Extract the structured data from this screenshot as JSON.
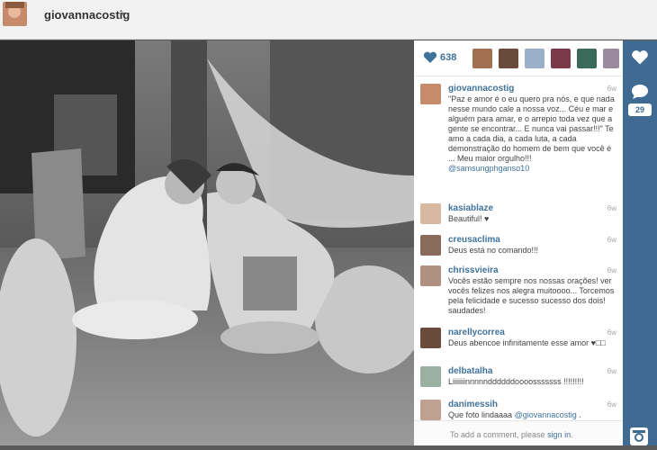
{
  "header": {
    "username": "giovannacostig",
    "caret": "▾"
  },
  "post": {
    "likes_count": "638",
    "comment_count": "29",
    "caption": {
      "username": "giovannacostig",
      "time": "6w",
      "text": "\"Paz e amor é o eu quero pra nós, e que nada nesse mundo cale a nossa voz... Céu e mar e alguém para amar, e o arrepio toda vez que a gente se encontrar... E nunca vai passar!!!\" Te amo a cada dia, a cada luta, a cada demonstração do homem de bem que você é ... Meu maior orgulho!!!",
      "mention": "@samsungphganso10"
    },
    "comments": [
      {
        "username": "kasiablaze",
        "time": "6w",
        "text": "Beautiful! ♥"
      },
      {
        "username": "creusaclima",
        "time": "6w",
        "text": "Deus está no comando!!!"
      },
      {
        "username": "chrissvieira",
        "time": "6w",
        "text": "Vocês estão sempre nos nossas orações! ver vocês felizes nos alegra muitoooo... Torcemos pela felicidade e sucesso sucesso dos dois! saudades!"
      },
      {
        "username": "narellycorrea",
        "time": "6w",
        "text": "Deus abencoe infinitamente esse amor ♥□□"
      },
      {
        "username": "delbatalha",
        "time": "6w",
        "text": "Liiiiiiinnnnnddddddoooosssssss !!!!!!!!!"
      },
      {
        "username": "danimessih",
        "time": "6w",
        "text": "Que foto lindaaaa ",
        "mention": "@giovannacostig ."
      }
    ],
    "add_comment": {
      "prompt": "To add a comment, please ",
      "link": "sign in",
      "end": "."
    }
  },
  "colors": {
    "link": "#3f729b",
    "sidebar": "#3f6b93"
  },
  "icons": [
    "heart-icon",
    "comment-bubble-icon",
    "instagram-icon"
  ]
}
